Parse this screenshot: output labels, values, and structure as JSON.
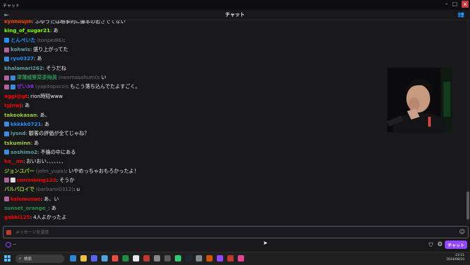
{
  "window": {
    "title": "チャット"
  },
  "header": {
    "title": "チャット"
  },
  "messages": [
    {
      "user": "kyohoujin",
      "user_sub": "",
      "text": "ふゆうたは暇事的に藤本の若さでてない",
      "color": "#ff4500",
      "badges": []
    },
    {
      "user": "king_of_sugar21",
      "user_sub": "",
      "text": "あ",
      "color": "#7fff00",
      "badges": []
    },
    {
      "user": "とんぺいた",
      "user_sub": "(tonpei86)",
      "text": "",
      "color": "#1e90ff",
      "badges": [
        "#1e90ff"
      ]
    },
    {
      "user": "kohwis",
      "user_sub": "",
      "text": "盛り上がってた",
      "color": "#5f9ea0",
      "badges": [
        "#b0649a"
      ]
    },
    {
      "user": "ryu0327",
      "user_sub": "",
      "text": "あ",
      "color": "#1e90ff",
      "badges": [
        "#3a8dde"
      ]
    },
    {
      "user": "khalamari262",
      "user_sub": "",
      "text": "そうだね",
      "color": "#5f9ea0",
      "badges": []
    },
    {
      "user": "津薄威寮菜茶侮美",
      "user_sub": "(neomasahumi)",
      "text": "い",
      "color": "#2e8b57",
      "badges": [
        "#b0649a",
        "#3a8dde"
      ]
    },
    {
      "user": "ぜい38",
      "user_sub": "(yapitopoco)",
      "text": "もこう落ち込んでたよすごく。",
      "color": "#8a2be2",
      "badges": [
        "#b0649a",
        "#3a8dde"
      ]
    },
    {
      "user": "aggi@gt",
      "user_sub": "",
      "text": "rion時短www",
      "color": "#ff0000",
      "badges": []
    },
    {
      "user": "tyjnwj",
      "user_sub": "",
      "text": "あ",
      "color": "#ff0000",
      "badges": []
    },
    {
      "user": "takeokasan",
      "user_sub": "",
      "text": "あ、",
      "color": "#9acd32",
      "badges": []
    },
    {
      "user": "kkkkk0721",
      "user_sub": "",
      "text": "あ",
      "color": "#1e90ff",
      "badges": [
        "#3a8dde"
      ]
    },
    {
      "user": "iysnd",
      "user_sub": "",
      "text": "観客の評価が全てじゃね？",
      "color": "#5f9ea0",
      "badges": [
        "#3a8dde"
      ]
    },
    {
      "user": "tskuminn",
      "user_sub": "",
      "text": "あ",
      "color": "#9acd32",
      "badges": []
    },
    {
      "user": "soshimo2",
      "user_sub": "",
      "text": "不倫の中にある",
      "color": "#5f9ea0",
      "badges": [
        "#3a8dde"
      ]
    },
    {
      "user": "ka__nn",
      "user_sub": "",
      "text": "おいおい、、、、、、、",
      "color": "#ff0000",
      "badges": []
    },
    {
      "user": "ジョンユパー",
      "user_sub": "(john_yupa)",
      "text": "いやめっちゃおもろかったよ！",
      "color": "#9acd32",
      "badges": []
    },
    {
      "user": "corrinking123",
      "user_sub": "",
      "text": "そうか",
      "color": "#ff0000",
      "badges": [
        "#b0649a",
        "#dddddd"
      ]
    },
    {
      "user": "バルバロイで",
      "user_sub": "(barbaroi0312)",
      "text": "u",
      "color": "#9acd32",
      "badges": []
    },
    {
      "user": "kslomusoo",
      "user_sub": "",
      "text": "あ、い",
      "color": "#ff0000",
      "badges": [
        "#b0649a"
      ]
    },
    {
      "user": "sunset_orange_",
      "user_sub": "",
      "text": "あ",
      "color": "#2e8b57",
      "badges": []
    },
    {
      "user": "gakki125",
      "user_sub": "",
      "text": "4人よかったよ",
      "color": "#ff0000",
      "badges": []
    }
  ],
  "input": {
    "placeholder": "メッセージを送信"
  },
  "chat_footer": {
    "points": "--",
    "send_label": "チャット"
  },
  "taskbar": {
    "search_label": "検索",
    "time": "23:11",
    "date": "2024/08/10"
  },
  "colors": {
    "accent": "#9147ff",
    "background": "#18181b"
  },
  "icons": [
    "close-icon",
    "user-manage-icon",
    "emote-icon",
    "shield-icon",
    "gear-icon",
    "search-icon",
    "windows-start-icon"
  ]
}
